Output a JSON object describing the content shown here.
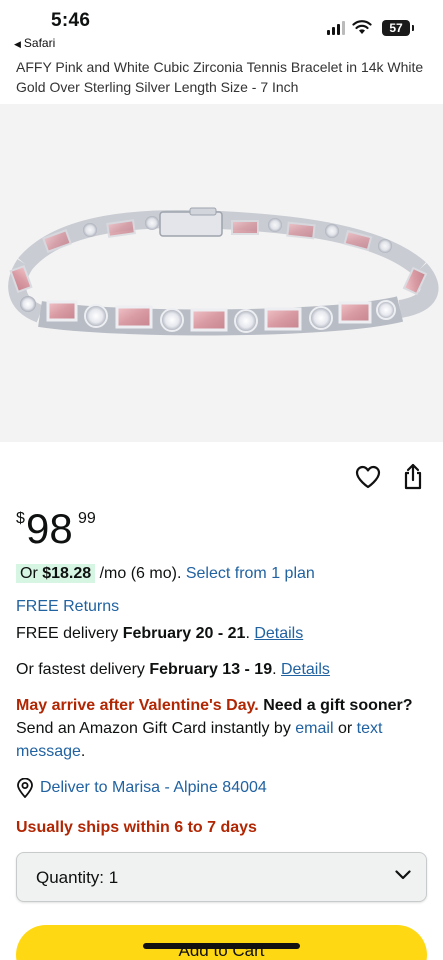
{
  "status_bar": {
    "time": "5:46",
    "back_app": "Safari",
    "battery": "57"
  },
  "product": {
    "title": "AFFY Pink and White Cubic Zirconia Tennis Bracelet in 14k White Gold Over Sterling Silver Length Size - 7 Inch",
    "image_icon": "tennis-bracelet-image"
  },
  "price": {
    "currency": "$",
    "whole": "98",
    "fraction": "99"
  },
  "monthly": {
    "prefix": "Or ",
    "amount": "$18.28",
    "term": " /mo (6 mo). ",
    "link": "Select from 1 plan"
  },
  "returns": {
    "label": "FREE Returns"
  },
  "delivery": {
    "prefix": "FREE delivery ",
    "dates": "February 20 - 21",
    "sep": ". ",
    "link": "Details"
  },
  "fastest": {
    "prefix": "Or fastest delivery ",
    "dates": "February 13 - 19",
    "sep": ". ",
    "link": "Details"
  },
  "gift": {
    "warning": "May arrive after Valentine's Day.",
    "bold": " Need a gift sooner?",
    "text": " Send an Amazon Gift Card instantly by ",
    "email_link": "email",
    "or": " or ",
    "text_link": "text message",
    "end": "."
  },
  "location": {
    "label": "Deliver to Marisa - Alpine 84004"
  },
  "stock": {
    "label": "Usually ships within 6 to 7 days"
  },
  "quantity": {
    "label": "Quantity:",
    "value": "1"
  },
  "cart": {
    "label": "Add to Cart"
  },
  "colors": {
    "link": "#2162a1",
    "deal_red": "#b12704",
    "cart_yellow": "#ffd814",
    "installment_bg": "#d6f5e3"
  }
}
